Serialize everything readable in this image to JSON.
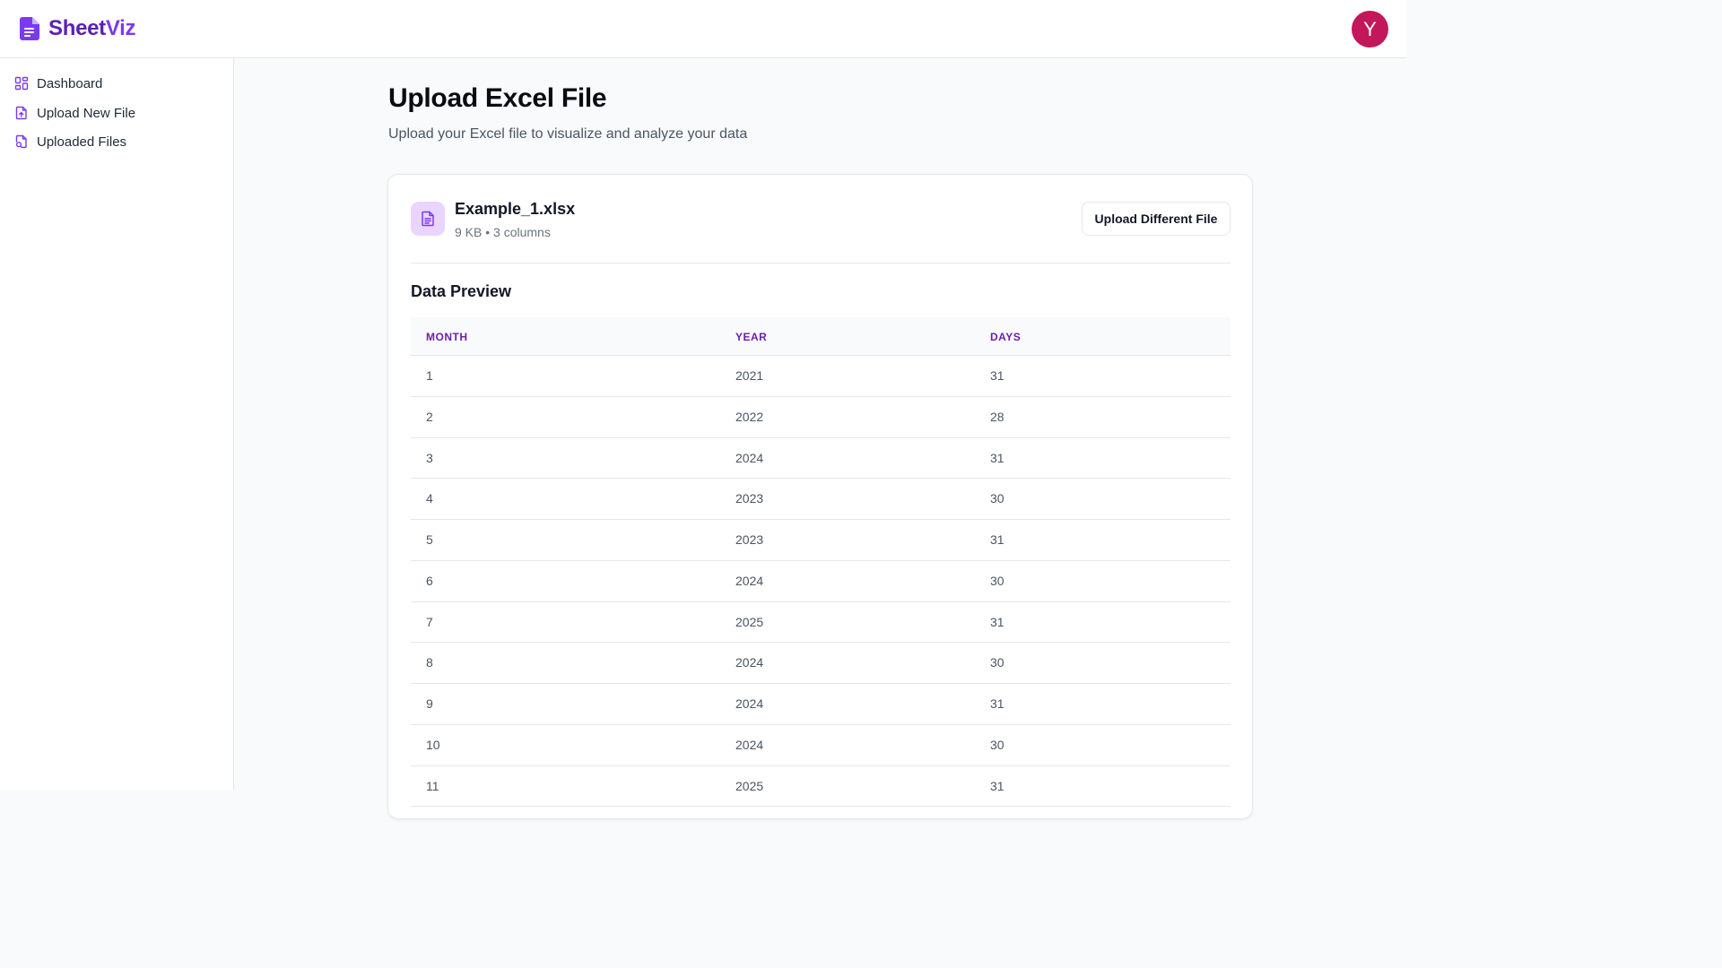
{
  "app": {
    "name_part1": "Sheet",
    "name_part2": "Viz",
    "avatar_initial": "Y"
  },
  "sidebar": {
    "items": [
      {
        "label": "Dashboard",
        "icon": "dashboard-icon"
      },
      {
        "label": "Upload New File",
        "icon": "file-upload-icon"
      },
      {
        "label": "Uploaded Files",
        "icon": "file-search-icon"
      }
    ]
  },
  "main": {
    "title": "Upload Excel File",
    "subtitle": "Upload your Excel file to visualize and analyze your data"
  },
  "file": {
    "name": "Example_1.xlsx",
    "meta": "9 KB • 3 columns",
    "upload_button": "Upload Different File"
  },
  "preview": {
    "title": "Data Preview",
    "columns": [
      "MONTH",
      "YEAR",
      "DAYS"
    ],
    "rows": [
      [
        "1",
        "2021",
        "31"
      ],
      [
        "2",
        "2022",
        "28"
      ],
      [
        "3",
        "2024",
        "31"
      ],
      [
        "4",
        "2023",
        "30"
      ],
      [
        "5",
        "2023",
        "31"
      ],
      [
        "6",
        "2024",
        "30"
      ],
      [
        "7",
        "2025",
        "31"
      ],
      [
        "8",
        "2024",
        "30"
      ],
      [
        "9",
        "2024",
        "31"
      ],
      [
        "10",
        "2024",
        "30"
      ],
      [
        "11",
        "2025",
        "31"
      ]
    ]
  },
  "colors": {
    "brand": "#5b21b6",
    "accent": "#7c3aed",
    "avatar_bg": "#c2185b",
    "header_text": "#6b21a8"
  }
}
